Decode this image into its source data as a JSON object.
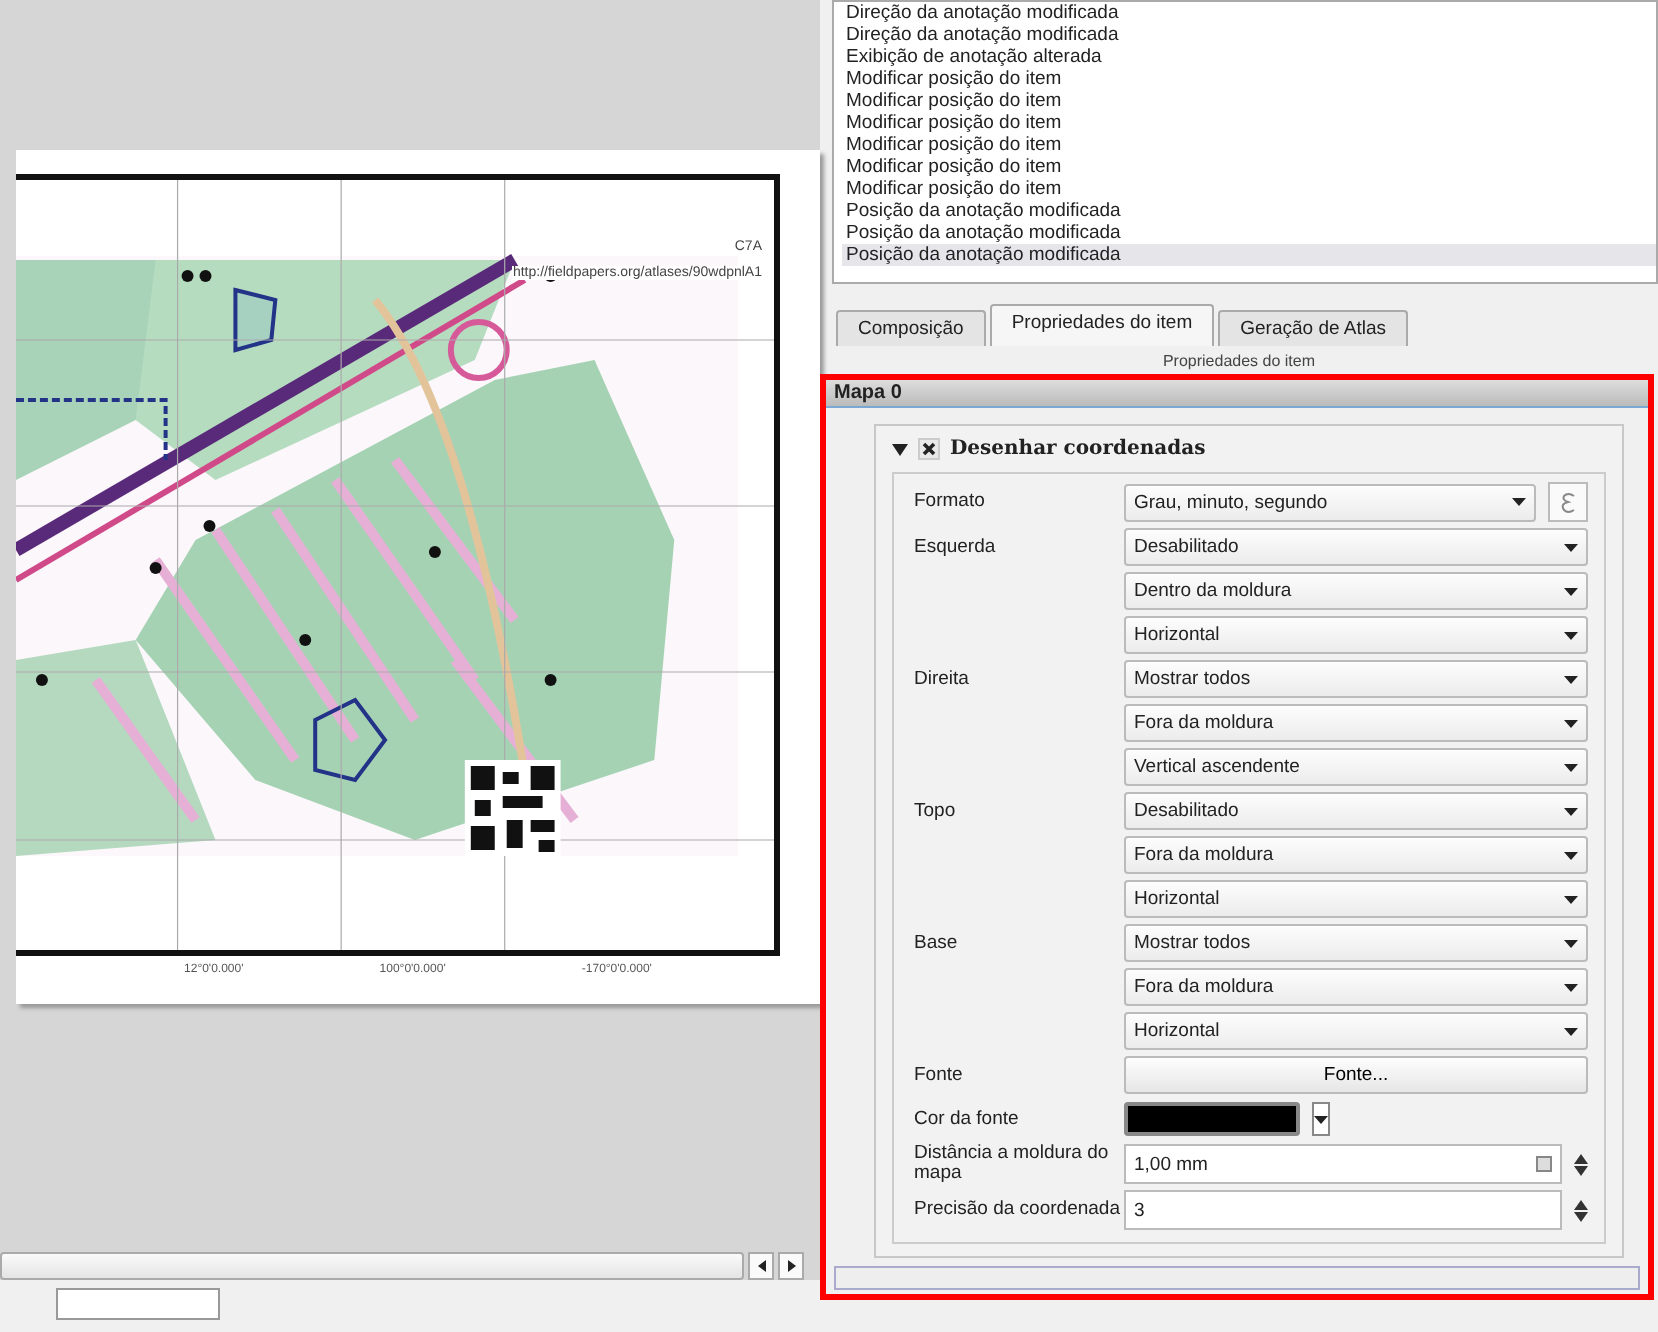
{
  "map_page": {
    "attribution": "C7A",
    "url": "http://fieldpapers.org/atlases/90wdpnlA1",
    "bottom_labels": [
      "12°0'0.000'",
      "100°0'0.000'",
      "-170°0'0.000'"
    ]
  },
  "history": {
    "items": [
      {
        "text": "Direção da anotação modificada",
        "selected": false
      },
      {
        "text": "Direção da anotação modificada",
        "selected": false
      },
      {
        "text": "Exibição de anotação alterada",
        "selected": false
      },
      {
        "text": "Modificar posição do item",
        "selected": false
      },
      {
        "text": "Modificar posição do item",
        "selected": false
      },
      {
        "text": "Modificar posição do item",
        "selected": false
      },
      {
        "text": "Modificar posição do item",
        "selected": false
      },
      {
        "text": "Modificar posição do item",
        "selected": false
      },
      {
        "text": "Modificar posição do item",
        "selected": false
      },
      {
        "text": "Posição da anotação modificada",
        "selected": false
      },
      {
        "text": "Posição da anotação modificada",
        "selected": false
      },
      {
        "text": "Posição da anotação modificada",
        "selected": true
      }
    ]
  },
  "tabs": [
    {
      "label": "Composição",
      "selected": false
    },
    {
      "label": "Propriedades do item",
      "selected": true
    },
    {
      "label": "Geração de Atlas",
      "selected": false
    }
  ],
  "panel_title": "Propriedades do item",
  "properties": {
    "title": "Mapa 0",
    "group": {
      "label": "Desenhar coordenadas",
      "checked": true,
      "expanded": true
    },
    "rows": [
      {
        "kind": "combo_expr",
        "label": "Formato",
        "value": "Grau, minuto, segundo"
      },
      {
        "kind": "combo",
        "label": "Esquerda",
        "value": "Desabilitado"
      },
      {
        "kind": "combo",
        "value": "Dentro da moldura"
      },
      {
        "kind": "combo",
        "value": "Horizontal"
      },
      {
        "kind": "combo",
        "label": "Direita",
        "value": "Mostrar todos"
      },
      {
        "kind": "combo",
        "value": "Fora da moldura"
      },
      {
        "kind": "combo",
        "value": "Vertical ascendente"
      },
      {
        "kind": "combo",
        "label": "Topo",
        "value": "Desabilitado"
      },
      {
        "kind": "combo",
        "value": "Fora da moldura"
      },
      {
        "kind": "combo",
        "value": "Horizontal"
      },
      {
        "kind": "combo",
        "label": "Base",
        "value": "Mostrar todos"
      },
      {
        "kind": "combo",
        "value": "Fora da moldura"
      },
      {
        "kind": "combo",
        "value": "Horizontal"
      },
      {
        "kind": "button",
        "label": "Fonte",
        "value": "Fonte..."
      },
      {
        "kind": "color",
        "label": "Cor da fonte",
        "color": "#000000"
      },
      {
        "kind": "spin_clear",
        "label": "Distância a moldura do mapa",
        "value": "1,00 mm"
      },
      {
        "kind": "spin",
        "label": "Precisão da coordenada",
        "value": "3"
      }
    ]
  }
}
